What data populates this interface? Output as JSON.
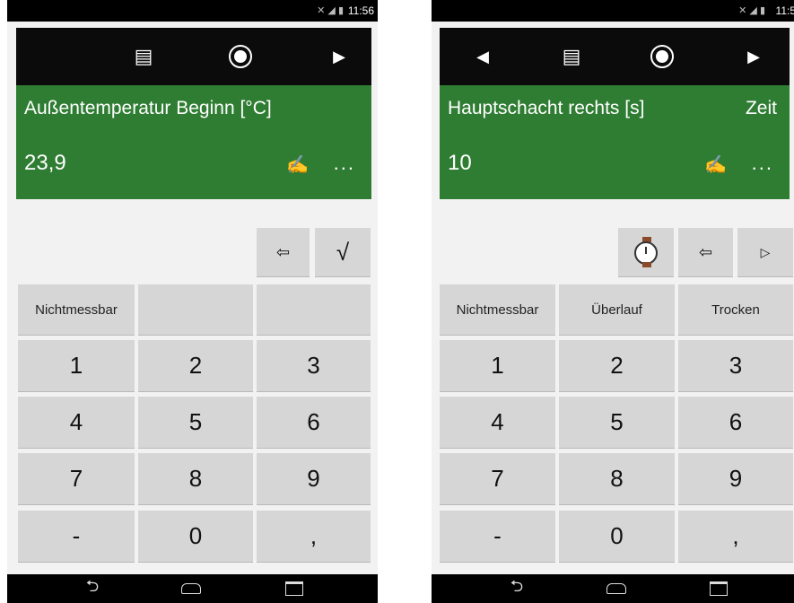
{
  "screens": [
    {
      "status_time": "11:56",
      "nav": {
        "prev": "",
        "list": "▤",
        "record": "",
        "next": "▶"
      },
      "header": {
        "title": "Außentemperatur Beginn [°C]",
        "mode": "",
        "value": "23,9",
        "pen": "✍",
        "more": "..."
      },
      "tools": {
        "watch": "",
        "backspace": "⇦",
        "action": "√"
      },
      "options": [
        "Nicht messbar",
        "",
        ""
      ],
      "keys": [
        "1",
        "2",
        "3",
        "4",
        "5",
        "6",
        "7",
        "8",
        "9",
        "-",
        "0",
        ","
      ]
    },
    {
      "status_time": "11:5",
      "nav": {
        "prev": "◀",
        "list": "▤",
        "record": "",
        "next": "▶"
      },
      "header": {
        "title": "Hauptschacht rechts [s]",
        "mode": "Zeit",
        "value": "10",
        "pen": "✍",
        "more": "..."
      },
      "tools": {
        "watch": "watch",
        "backspace": "⇦",
        "action": "▷"
      },
      "options": [
        "Nicht messbar",
        "Überlauf",
        "Trocken"
      ],
      "keys": [
        "1",
        "2",
        "3",
        "4",
        "5",
        "6",
        "7",
        "8",
        "9",
        "-",
        "0",
        ","
      ]
    }
  ],
  "system_nav": {
    "back": "⮌",
    "home": "",
    "recent": ""
  },
  "icons": {
    "battery": "battery-icon",
    "signal": "signal-icon",
    "mute": "mute-icon"
  },
  "colors": {
    "header_bar": "#0b0b0b",
    "green_panel": "#2f7d33",
    "key_bg": "#d6d6d6"
  }
}
